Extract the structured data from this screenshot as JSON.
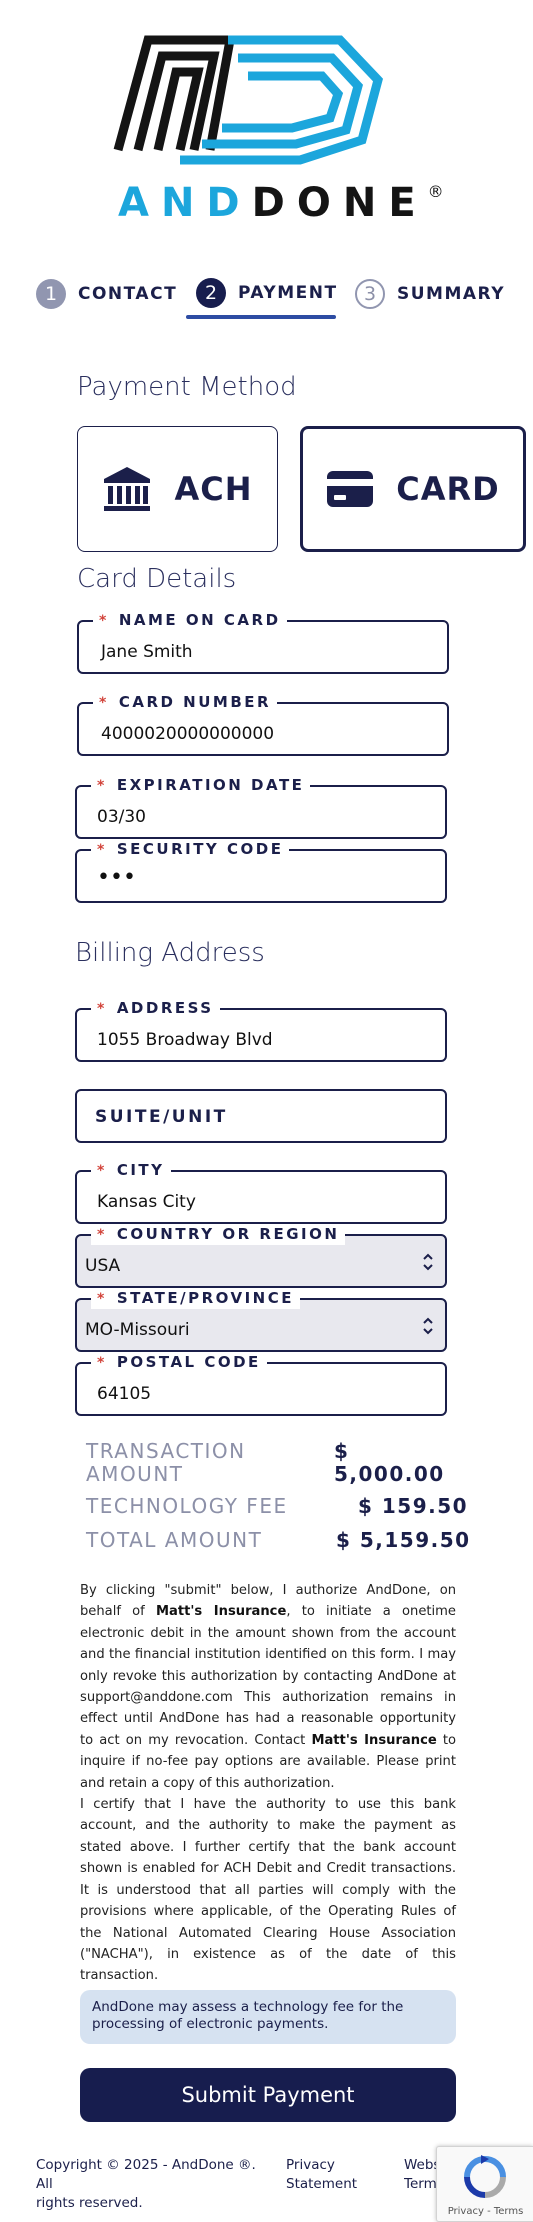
{
  "brand": {
    "name_part1": "AND",
    "name_part2": "DONE",
    "registered": "®",
    "accent": "#1ca6dc",
    "dark": "#141414"
  },
  "steps": [
    {
      "number": "1",
      "label": "CONTACT",
      "state": "done"
    },
    {
      "number": "2",
      "label": "PAYMENT",
      "state": "active"
    },
    {
      "number": "3",
      "label": "SUMMARY",
      "state": "todo"
    }
  ],
  "payment_method": {
    "title": "Payment Method",
    "ach_label": "ACH",
    "card_label": "CARD",
    "selected": "CARD"
  },
  "card_details": {
    "title": "Card Details",
    "name_label": "NAME ON CARD",
    "name_value": "Jane Smith",
    "number_label": "CARD NUMBER",
    "number_value": "4000020000000000",
    "expiry_label": "EXPIRATION DATE",
    "expiry_value": "03/30",
    "cvv_label": "SECURITY CODE",
    "cvv_value": "•••"
  },
  "billing": {
    "title": "Billing Address",
    "address_label": "ADDRESS",
    "address_value": "1055 Broadway Blvd",
    "suite_placeholder": "SUITE/UNIT",
    "city_label": "CITY",
    "city_value": "Kansas City",
    "country_label": "COUNTRY OR REGION",
    "country_value": "USA",
    "state_label": "STATE/PROVINCE",
    "state_value": "MO-Missouri",
    "postal_label": "POSTAL CODE",
    "postal_value": "64105"
  },
  "required_mark": "*",
  "totals": {
    "amount_label_1": "TRANSACTION",
    "amount_label_2": "AMOUNT",
    "amount_value_1": "$",
    "amount_value_2": "5,000.00",
    "fee_label": "TECHNOLOGY FEE",
    "fee_value": "$ 159.50",
    "total_label": "TOTAL AMOUNT",
    "total_value": "$ 5,159.50"
  },
  "terms": {
    "p1_a": "By clicking \"submit\" below, I authorize AndDone, on behalf of ",
    "merchant": "Matt's Insurance",
    "p1_b": ", to initiate a onetime electronic debit in the amount shown from the account and the financial institution identified on this form. I may only revoke this authorization by contacting AndDone at support@anddone.com This authorization remains in effect until AndDone has had a reasonable opportunity to act on my revocation. Contact ",
    "p1_c": " to inquire if no-fee pay options are available. Please print and retain a copy of this authorization.",
    "p2": "I certify that I have the authority to use this bank account, and the authority to make the payment as stated above. I further certify that the bank account shown is enabled for ACH Debit and Credit transactions. It is understood that all parties will comply with the provisions where applicable, of the Operating Rules of the National Automated Clearing House Association (\"NACHA\"), in existence as of the date of this transaction."
  },
  "notice": "AndDone may assess a technology fee for the processing of electronic payments.",
  "submit_label": "Submit Payment",
  "footer": {
    "copyright_1": "Copyright © 2025 - AndDone ®. All",
    "copyright_2": "rights reserved.",
    "privacy_1": "Privacy",
    "privacy_2": "Statement",
    "web_1": "Webs",
    "web_2": "Term"
  },
  "recaptcha": {
    "links": "Privacy - Terms"
  }
}
